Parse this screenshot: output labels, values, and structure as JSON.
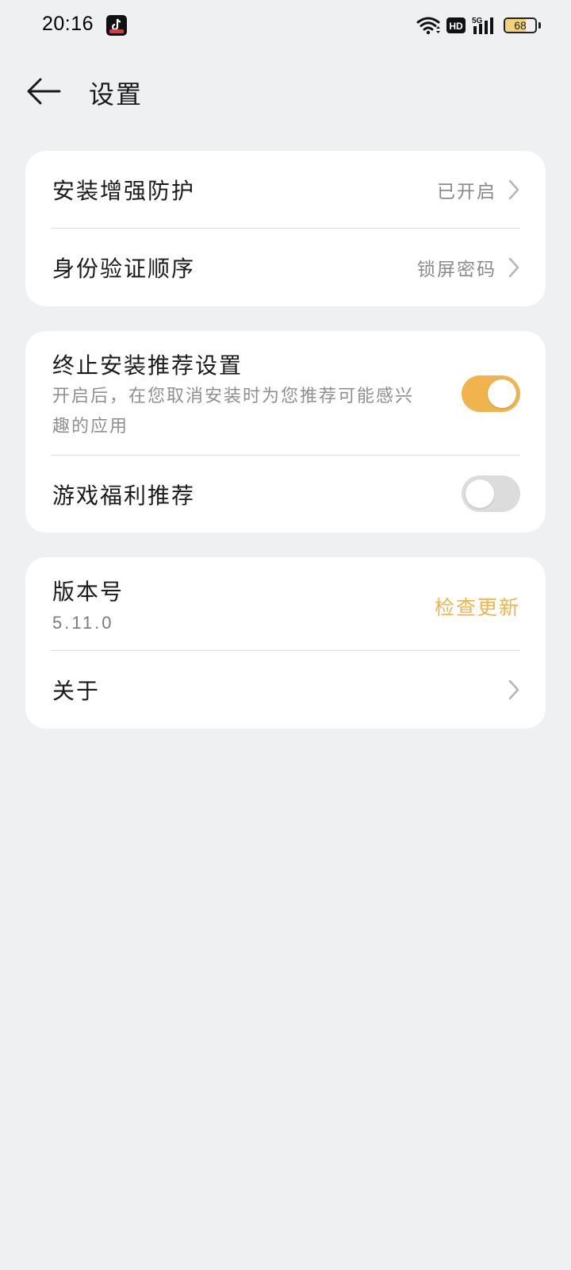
{
  "status_bar": {
    "time": "20:16",
    "battery_level": "68",
    "battery_fraction": 0.68,
    "icons": [
      "app-notification-icon",
      "wifi-icon",
      "hd-icon",
      "5g-signal-icon",
      "battery-icon"
    ],
    "accent_color": "#f3d27a"
  },
  "header": {
    "title": "设置",
    "back_icon": "back-arrow-icon"
  },
  "card1": {
    "install_protection": {
      "label": "安装增强防护",
      "value": "已开启"
    },
    "auth_order": {
      "label": "身份验证顺序",
      "value": "锁屏密码"
    }
  },
  "card2": {
    "uninstall_recommend": {
      "label": "终止安装推荐设置",
      "description": "开启后，在您取消安装时为您推荐可能感兴趣的应用",
      "enabled": true
    },
    "game_benefits": {
      "label": "游戏福利推荐",
      "enabled": false
    }
  },
  "card3": {
    "version": {
      "label": "版本号",
      "number": "5.11.0",
      "check_update": "检查更新"
    },
    "about": {
      "label": "关于"
    }
  },
  "colors": {
    "background": "#eff0f2",
    "card": "#ffffff",
    "accent": "#f0b34d",
    "toggle_off": "#dcdcdc",
    "secondary_text": "#8a8a8a"
  }
}
